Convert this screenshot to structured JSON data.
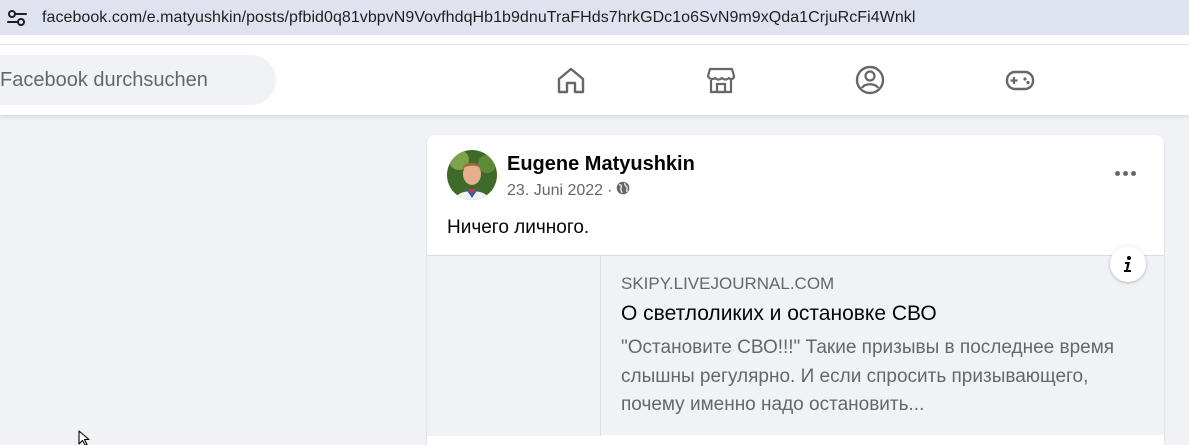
{
  "browser": {
    "url": "facebook.com/e.matyushkin/posts/pfbid0q81vbpvN9VovfhdqHb1b9dnuTraFHds7hrkGDc1o6SvN9m9xQda1CrjuRcFi4Wnkl",
    "site_info_icon": "tune-icon"
  },
  "header": {
    "search_placeholder": "Facebook durchsuchen",
    "nav_icons": [
      "home-icon",
      "marketplace-icon",
      "groups-icon",
      "gaming-icon"
    ]
  },
  "post": {
    "author": "Eugene Matyushkin",
    "date": "23. Juni 2022",
    "separator": "·",
    "privacy_icon": "globe-icon",
    "text": "Ничего личного.",
    "link_preview": {
      "domain": "SKIPY.LIVEJOURNAL.COM",
      "title": "О светлоликих и остановке СВО",
      "description": "\"Остановите СВО!!!\" Такие призывы в последнее время слышны регулярно. И если спросить призывающего, почему именно надо остановить..."
    },
    "info_icon": "info-icon",
    "more_icon": "more-options-icon"
  },
  "colors": {
    "fb_blue": "#1877f2",
    "secondary_text": "#65676b",
    "background": "#f0f2f5",
    "address_bar": "#dfe3f0"
  }
}
